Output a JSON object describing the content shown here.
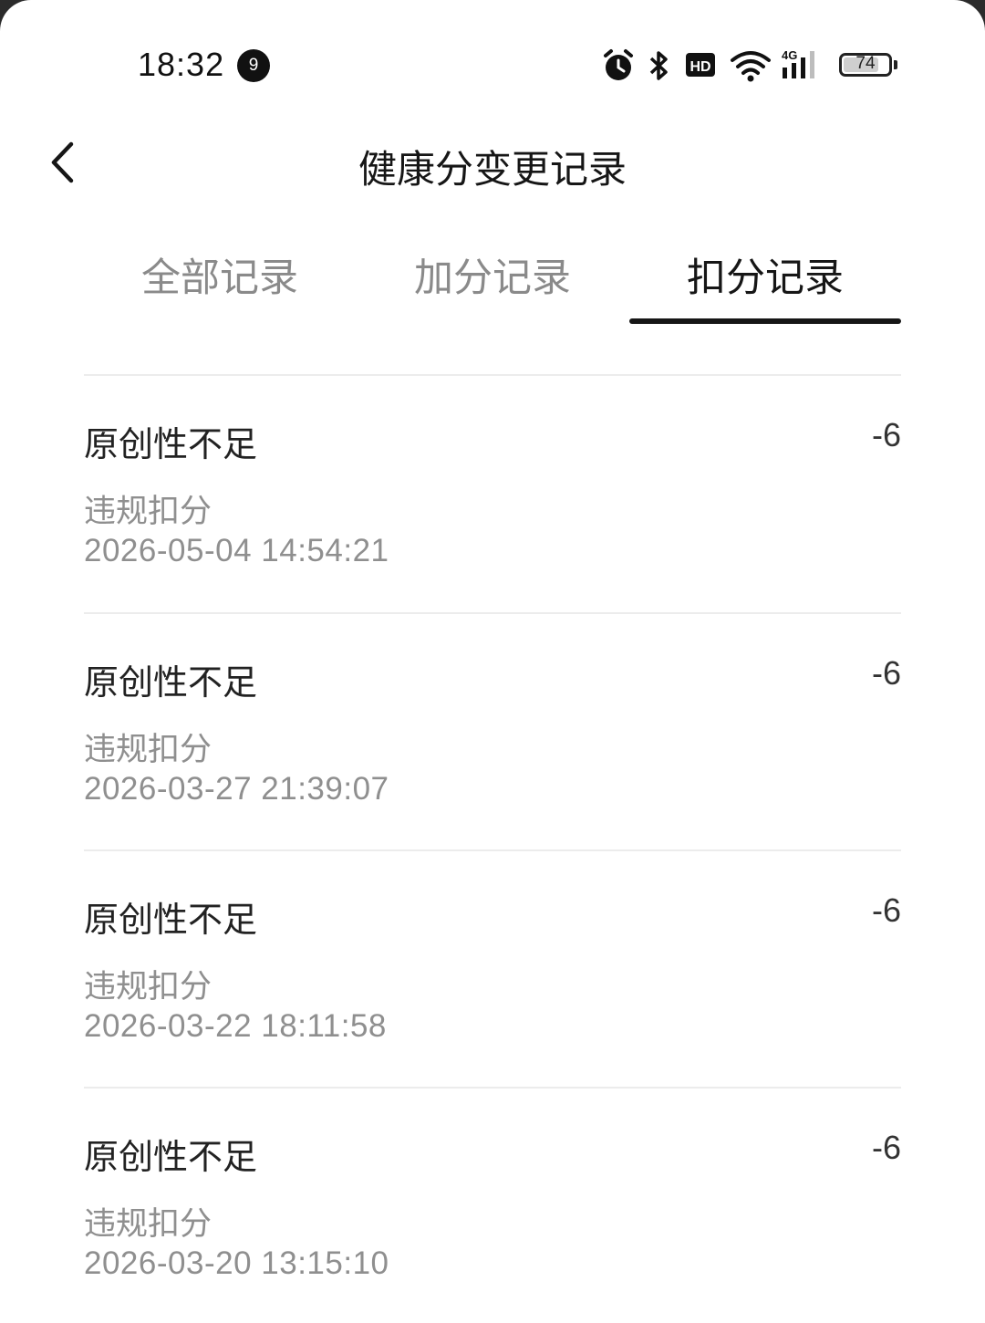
{
  "status_bar": {
    "time": "18:32",
    "notification_count": "9",
    "battery_level": "74",
    "icons": [
      "alarm-icon",
      "bluetooth-icon",
      "hd-icon",
      "wifi-icon",
      "signal-4g-icon",
      "battery-icon"
    ]
  },
  "header": {
    "title": "健康分变更记录",
    "back_icon": "chevron-left-icon"
  },
  "tabs": [
    {
      "label": "全部记录",
      "active": false
    },
    {
      "label": "加分记录",
      "active": false
    },
    {
      "label": "扣分记录",
      "active": true
    }
  ],
  "records": [
    {
      "title": "原创性不足",
      "score": "-6",
      "type": "违规扣分",
      "time": "2026-05-04 14:54:21"
    },
    {
      "title": "原创性不足",
      "score": "-6",
      "type": "违规扣分",
      "time": "2026-03-27 21:39:07"
    },
    {
      "title": "原创性不足",
      "score": "-6",
      "type": "违规扣分",
      "time": "2026-03-22 18:11:58"
    },
    {
      "title": "原创性不足",
      "score": "-6",
      "type": "违规扣分",
      "time": "2026-03-20 13:15:10"
    }
  ]
}
